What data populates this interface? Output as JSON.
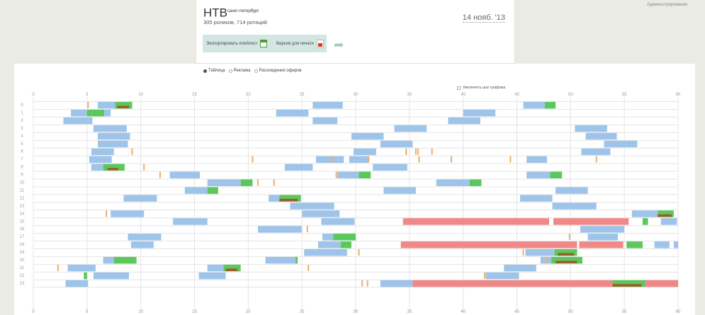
{
  "header": {
    "channel_name": "НТВ",
    "channel_city": "санкт-петербург",
    "stats": "305 роликов, 714 ротаций",
    "date": "14 нояб. '13",
    "export_label": "Экспортировать плейлист",
    "print_label": "Версия для печати",
    "admin_label": "Администрирование"
  },
  "view_tabs": [
    {
      "label": "Таблица",
      "selected": true
    },
    {
      "label": "Реклама",
      "selected": false
    },
    {
      "label": "Расхождения эфиров",
      "selected": false
    }
  ],
  "zoom_label": "Увеличить шаг графика",
  "colors": {
    "blue": "#9fc4ea",
    "green": "#5cc85c",
    "brown": "#9a5d2a",
    "orange": "#e8b06a",
    "red": "#f08888",
    "grid": "#e4e4e4",
    "tick": "#999999"
  },
  "chart_data": {
    "type": "gantt",
    "x_axis": {
      "min": 0,
      "max": 60,
      "ticks": [
        0,
        5,
        10,
        15,
        20,
        25,
        30,
        35,
        40,
        45,
        50,
        55,
        60
      ],
      "unit": "minute"
    },
    "y_axis": {
      "categories": [
        0,
        1,
        2,
        3,
        4,
        5,
        6,
        7,
        8,
        9,
        10,
        11,
        12,
        13,
        14,
        15,
        16,
        17,
        18,
        19,
        20,
        21,
        22,
        23
      ],
      "unit": "hour"
    },
    "grid": true,
    "bars": [
      {
        "h": 0,
        "s": 6,
        "e": 7.6,
        "c": "blue"
      },
      {
        "h": 0,
        "s": 7.6,
        "e": 9.2,
        "c": "green"
      },
      {
        "h": 0,
        "s": 7.8,
        "e": 8.9,
        "c": "brown"
      },
      {
        "h": 0,
        "s": 26,
        "e": 28.8,
        "c": "blue"
      },
      {
        "h": 0,
        "s": 45.6,
        "e": 47.6,
        "c": "blue"
      },
      {
        "h": 0,
        "s": 47.6,
        "e": 48.6,
        "c": "green"
      },
      {
        "h": 1,
        "s": 3.5,
        "e": 5,
        "c": "blue"
      },
      {
        "h": 1,
        "s": 5,
        "e": 5.5,
        "c": "green"
      },
      {
        "h": 1,
        "s": 5.5,
        "e": 6.6,
        "c": "green"
      },
      {
        "h": 1,
        "s": 6.6,
        "e": 7.2,
        "c": "blue"
      },
      {
        "h": 1,
        "s": 22.6,
        "e": 25.6,
        "c": "blue"
      },
      {
        "h": 1,
        "s": 40,
        "e": 43,
        "c": "blue"
      },
      {
        "h": 2,
        "s": 2.8,
        "e": 5.5,
        "c": "blue"
      },
      {
        "h": 2,
        "s": 26,
        "e": 28.3,
        "c": "blue"
      },
      {
        "h": 2,
        "s": 38.6,
        "e": 41.6,
        "c": "blue"
      },
      {
        "h": 3,
        "s": 5.6,
        "e": 8.7,
        "c": "blue"
      },
      {
        "h": 3,
        "s": 33.6,
        "e": 36.6,
        "c": "blue"
      },
      {
        "h": 3,
        "s": 50.4,
        "e": 53.4,
        "c": "blue"
      },
      {
        "h": 4,
        "s": 6,
        "e": 9,
        "c": "blue"
      },
      {
        "h": 4,
        "s": 29.6,
        "e": 32.6,
        "c": "blue"
      },
      {
        "h": 4,
        "s": 51.4,
        "e": 54.3,
        "c": "blue"
      },
      {
        "h": 5,
        "s": 6,
        "e": 8.8,
        "c": "blue"
      },
      {
        "h": 5,
        "s": 32.3,
        "e": 35.3,
        "c": "blue"
      },
      {
        "h": 5,
        "s": 53.1,
        "e": 56.2,
        "c": "blue"
      },
      {
        "h": 6,
        "s": 5.4,
        "e": 7.5,
        "c": "blue"
      },
      {
        "h": 6,
        "s": 29.8,
        "e": 31.9,
        "c": "blue"
      },
      {
        "h": 6,
        "s": 51,
        "e": 53.7,
        "c": "blue"
      },
      {
        "h": 7,
        "s": 5.2,
        "e": 7.3,
        "c": "blue"
      },
      {
        "h": 7,
        "s": 26.3,
        "e": 28.3,
        "c": "blue"
      },
      {
        "h": 7,
        "s": 28.3,
        "e": 28.9,
        "c": "blue"
      },
      {
        "h": 7,
        "s": 29.4,
        "e": 31.2,
        "c": "blue"
      },
      {
        "h": 7,
        "s": 45.9,
        "e": 47.8,
        "c": "blue"
      },
      {
        "h": 8,
        "s": 5.4,
        "e": 6.5,
        "c": "blue"
      },
      {
        "h": 8,
        "s": 6.5,
        "e": 8.5,
        "c": "green"
      },
      {
        "h": 8,
        "s": 6.9,
        "e": 7.9,
        "c": "brown"
      },
      {
        "h": 8,
        "s": 23.4,
        "e": 26,
        "c": "blue"
      },
      {
        "h": 8,
        "s": 31.6,
        "e": 34.8,
        "c": "blue"
      },
      {
        "h": 9,
        "s": 12.7,
        "e": 15.5,
        "c": "blue"
      },
      {
        "h": 9,
        "s": 28.3,
        "e": 30.3,
        "c": "blue"
      },
      {
        "h": 9,
        "s": 30.3,
        "e": 31.4,
        "c": "green"
      },
      {
        "h": 9,
        "s": 45.9,
        "e": 48.1,
        "c": "blue"
      },
      {
        "h": 9,
        "s": 48.1,
        "e": 49.2,
        "c": "green"
      },
      {
        "h": 10,
        "s": 16.2,
        "e": 19.3,
        "c": "blue"
      },
      {
        "h": 10,
        "s": 19.3,
        "e": 20.4,
        "c": "green"
      },
      {
        "h": 10,
        "s": 37.5,
        "e": 40.6,
        "c": "blue"
      },
      {
        "h": 10,
        "s": 40.6,
        "e": 41.7,
        "c": "green"
      },
      {
        "h": 11,
        "s": 14.1,
        "e": 16.2,
        "c": "blue"
      },
      {
        "h": 11,
        "s": 16.2,
        "e": 17.2,
        "c": "green"
      },
      {
        "h": 11,
        "s": 32.6,
        "e": 35.6,
        "c": "blue"
      },
      {
        "h": 11,
        "s": 48.6,
        "e": 51.6,
        "c": "blue"
      },
      {
        "h": 12,
        "s": 8.4,
        "e": 11.5,
        "c": "blue"
      },
      {
        "h": 12,
        "s": 21.9,
        "e": 22.9,
        "c": "blue"
      },
      {
        "h": 12,
        "s": 22.9,
        "e": 24.9,
        "c": "green"
      },
      {
        "h": 12,
        "s": 22.9,
        "e": 24.6,
        "c": "brown"
      },
      {
        "h": 12,
        "s": 45.3,
        "e": 48.3,
        "c": "blue"
      },
      {
        "h": 13,
        "s": 23.9,
        "e": 28,
        "c": "blue"
      },
      {
        "h": 13,
        "s": 48.3,
        "e": 52.4,
        "c": "blue"
      },
      {
        "h": 14,
        "s": 7.2,
        "e": 10.3,
        "c": "blue"
      },
      {
        "h": 14,
        "s": 25,
        "e": 28,
        "c": "blue"
      },
      {
        "h": 14,
        "s": 28,
        "e": 28.5,
        "c": "blue"
      },
      {
        "h": 14,
        "s": 55.7,
        "e": 56.3,
        "c": "blue"
      },
      {
        "h": 14,
        "s": 56.3,
        "e": 58.1,
        "c": "blue"
      },
      {
        "h": 14,
        "s": 58.1,
        "e": 59.6,
        "c": "green"
      },
      {
        "h": 14,
        "s": 58.1,
        "e": 59.4,
        "c": "brown"
      },
      {
        "h": 15,
        "s": 13,
        "e": 16.2,
        "c": "blue"
      },
      {
        "h": 15,
        "s": 26.8,
        "e": 29.9,
        "c": "blue"
      },
      {
        "h": 15,
        "s": 34.4,
        "e": 48,
        "c": "red"
      },
      {
        "h": 15,
        "s": 48.4,
        "e": 55.4,
        "c": "red"
      },
      {
        "h": 15,
        "s": 56.7,
        "e": 57.2,
        "c": "green"
      },
      {
        "h": 15,
        "s": 58.4,
        "e": 59.9,
        "c": "blue"
      },
      {
        "h": 16,
        "s": 20.9,
        "e": 25,
        "c": "blue"
      },
      {
        "h": 16,
        "s": 50.9,
        "e": 55,
        "c": "blue"
      },
      {
        "h": 17,
        "s": 8.8,
        "e": 11.9,
        "c": "blue"
      },
      {
        "h": 17,
        "s": 26.9,
        "e": 27.9,
        "c": "blue"
      },
      {
        "h": 17,
        "s": 27.9,
        "e": 30,
        "c": "green"
      },
      {
        "h": 17,
        "s": 51.6,
        "e": 54.4,
        "c": "blue"
      },
      {
        "h": 18,
        "s": 9.1,
        "e": 11.2,
        "c": "blue"
      },
      {
        "h": 18,
        "s": 26.5,
        "e": 28.6,
        "c": "blue"
      },
      {
        "h": 18,
        "s": 28.6,
        "e": 29.6,
        "c": "green"
      },
      {
        "h": 18,
        "s": 34.2,
        "e": 50.6,
        "c": "red"
      },
      {
        "h": 18,
        "s": 50.8,
        "e": 54.9,
        "c": "red"
      },
      {
        "h": 18,
        "s": 55.2,
        "e": 56.7,
        "c": "green"
      },
      {
        "h": 18,
        "s": 57.8,
        "e": 59.2,
        "c": "blue"
      },
      {
        "h": 18,
        "s": 59.6,
        "e": 60,
        "c": "blue"
      },
      {
        "h": 19,
        "s": 25.2,
        "e": 29.2,
        "c": "blue"
      },
      {
        "h": 19,
        "s": 45.8,
        "e": 48.5,
        "c": "blue"
      },
      {
        "h": 19,
        "s": 48.5,
        "e": 50.6,
        "c": "green"
      },
      {
        "h": 19,
        "s": 48.8,
        "e": 50.3,
        "c": "brown"
      },
      {
        "h": 20,
        "s": 6.5,
        "e": 7.5,
        "c": "blue"
      },
      {
        "h": 20,
        "s": 7.5,
        "e": 9.6,
        "c": "green"
      },
      {
        "h": 20,
        "s": 21.6,
        "e": 24.4,
        "c": "blue"
      },
      {
        "h": 20,
        "s": 24.4,
        "e": 24.6,
        "c": "green"
      },
      {
        "h": 20,
        "s": 47.2,
        "e": 48.2,
        "c": "blue"
      },
      {
        "h": 20,
        "s": 48.2,
        "e": 51.1,
        "c": "green"
      },
      {
        "h": 20,
        "s": 48.6,
        "e": 50.6,
        "c": "brown"
      },
      {
        "h": 21,
        "s": 3.2,
        "e": 5.8,
        "c": "blue"
      },
      {
        "h": 21,
        "s": 16.2,
        "e": 17.7,
        "c": "blue"
      },
      {
        "h": 21,
        "s": 17.7,
        "e": 19.3,
        "c": "green"
      },
      {
        "h": 21,
        "s": 17.9,
        "e": 19,
        "c": "brown"
      },
      {
        "h": 21,
        "s": 43.8,
        "e": 46.8,
        "c": "blue"
      },
      {
        "h": 22,
        "s": 4.7,
        "e": 5,
        "c": "green"
      },
      {
        "h": 22,
        "s": 5.6,
        "e": 8.9,
        "c": "blue"
      },
      {
        "h": 22,
        "s": 15.4,
        "e": 17.9,
        "c": "blue"
      },
      {
        "h": 22,
        "s": 42.1,
        "e": 45.2,
        "c": "blue"
      },
      {
        "h": 23,
        "s": 3,
        "e": 5.1,
        "c": "blue"
      },
      {
        "h": 23,
        "s": 32.3,
        "e": 35.3,
        "c": "blue"
      },
      {
        "h": 23,
        "s": 35.3,
        "e": 53.9,
        "c": "red"
      },
      {
        "h": 23,
        "s": 53.9,
        "e": 56.9,
        "c": "green"
      },
      {
        "h": 23,
        "s": 53.9,
        "e": 56.6,
        "c": "brown"
      },
      {
        "h": 23,
        "s": 56.9,
        "e": 60,
        "c": "red"
      }
    ],
    "markers": [
      {
        "h": 0,
        "m": 5.1
      },
      {
        "h": 6,
        "m": 9.2
      },
      {
        "h": 6,
        "m": 34.7
      },
      {
        "h": 6,
        "m": 35.6
      },
      {
        "h": 6,
        "m": 35.8
      },
      {
        "h": 6,
        "m": 37.1
      },
      {
        "h": 7,
        "m": 20.4
      },
      {
        "h": 7,
        "m": 27.8
      },
      {
        "h": 7,
        "m": 31.2
      },
      {
        "h": 7,
        "m": 35.9
      },
      {
        "h": 7,
        "m": 38.9
      },
      {
        "h": 7,
        "m": 44.4
      },
      {
        "h": 7,
        "m": 52.4
      },
      {
        "h": 8,
        "m": 10.3
      },
      {
        "h": 9,
        "m": 11.8
      },
      {
        "h": 9,
        "m": 28.2
      },
      {
        "h": 10,
        "m": 20.9
      },
      {
        "h": 10,
        "m": 22.4
      },
      {
        "h": 14,
        "m": 6.8
      },
      {
        "h": 16,
        "m": 25.5
      },
      {
        "h": 17,
        "m": 49.9
      },
      {
        "h": 19,
        "m": 30.3
      },
      {
        "h": 19,
        "m": 45.6
      },
      {
        "h": 20,
        "m": 47.8
      },
      {
        "h": 21,
        "m": 2.3
      },
      {
        "h": 21,
        "m": 25.6
      },
      {
        "h": 22,
        "m": 42
      },
      {
        "h": 23,
        "m": 30.6
      },
      {
        "h": 23,
        "m": 31.1
      }
    ]
  }
}
